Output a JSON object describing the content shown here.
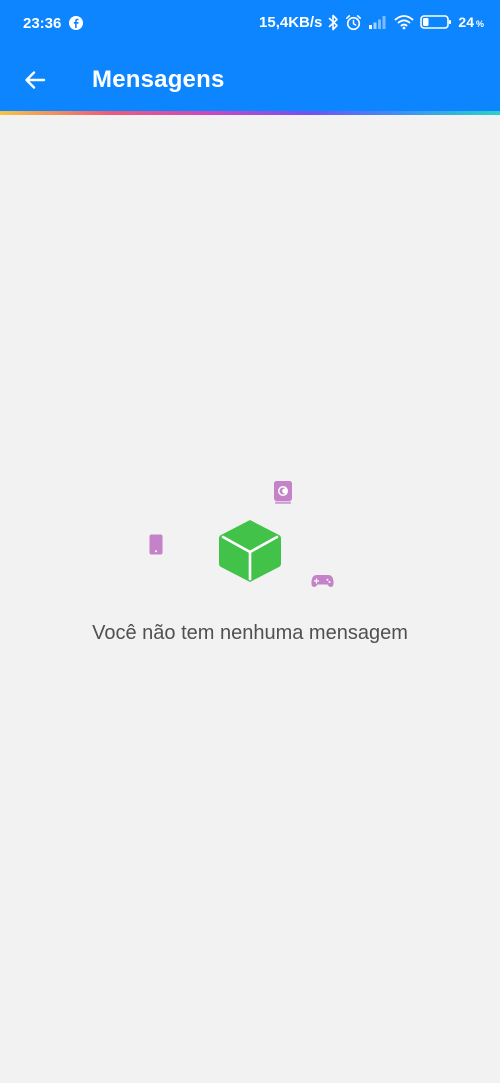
{
  "status_bar": {
    "time": "23:36",
    "network_speed": "15,4KB/s",
    "battery_percent": "24",
    "battery_percent_sign": "%",
    "left_icons": [
      "facebook-icon"
    ],
    "right_icons": [
      "bluetooth-icon",
      "alarm-icon",
      "signal-icon",
      "wifi-icon",
      "battery-icon"
    ]
  },
  "toolbar": {
    "back_icon": "arrow-left-icon",
    "title": "Mensagens"
  },
  "empty_state": {
    "message": "Você não tem nenhuma mensagem",
    "illustration_icons": [
      "green-box-icon",
      "phone-icon",
      "book-icon",
      "gamepad-icon"
    ]
  },
  "colors": {
    "header_bg": "#0d85ff",
    "page_bg": "#f2f2f2",
    "box_green": "#43c24a",
    "illustration_purple": "#c483c9",
    "text": "#505050"
  }
}
